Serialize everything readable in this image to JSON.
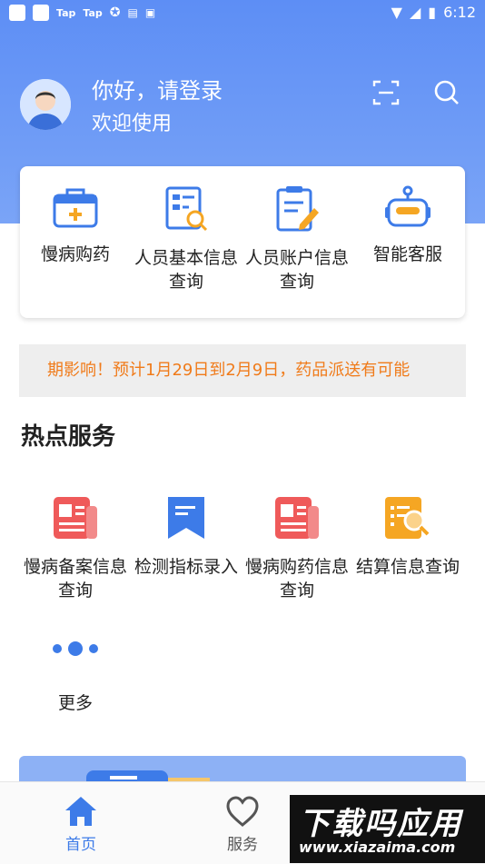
{
  "status_bar": {
    "left_items": [
      "Tap",
      "Tap"
    ],
    "time": "6:12"
  },
  "header": {
    "greeting": "你好，请登录",
    "welcome": "欢迎使用",
    "scan_icon": "scan-icon",
    "search_icon": "search-icon"
  },
  "quick_actions": [
    {
      "label": "慢病购药",
      "icon": "medical-kit-icon"
    },
    {
      "label": "人员基本信息查询",
      "icon": "document-search-icon"
    },
    {
      "label": "人员账户信息查询",
      "icon": "clipboard-edit-icon"
    },
    {
      "label": "智能客服",
      "icon": "robot-icon"
    }
  ],
  "notice": "期影响！预计1月29日到2月9日，药品派送有可能",
  "hot_services": {
    "title": "热点服务",
    "items": [
      {
        "label": "慢病备案信息查询",
        "icon": "news-doc-icon"
      },
      {
        "label": "检测指标录入",
        "icon": "bookmark-icon"
      },
      {
        "label": "慢病购药信息查询",
        "icon": "news-doc-icon"
      },
      {
        "label": "结算信息查询",
        "icon": "settlement-search-icon"
      },
      {
        "label": "更多",
        "icon": "more-dots-icon"
      }
    ]
  },
  "tabs": [
    {
      "label": "首页",
      "icon": "home-icon",
      "active": true
    },
    {
      "label": "服务",
      "icon": "heart-icon",
      "active": false
    }
  ],
  "watermark": {
    "line1": "下载吗应用",
    "line2": "www.xiazaima.com"
  },
  "colors": {
    "primary": "#4a7ee6",
    "hero": "#6b98f5",
    "notice_text": "#f07b1a",
    "red_icon": "#ef5a5a",
    "orange_icon": "#f5a623"
  }
}
